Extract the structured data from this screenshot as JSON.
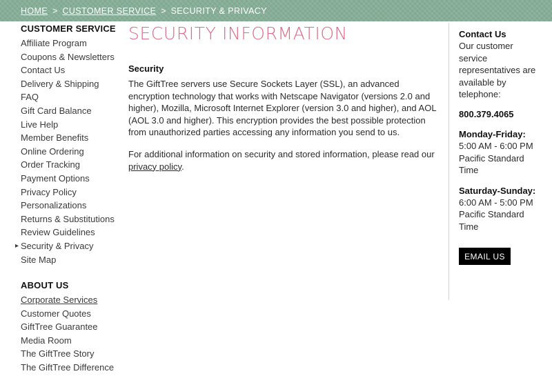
{
  "breadcrumb": {
    "items": [
      {
        "label": "HOME",
        "link": true
      },
      {
        "label": "CUSTOMER SERVICE",
        "link": true
      },
      {
        "label": "SECURITY & PRIVACY",
        "link": false
      }
    ],
    "separator": ">"
  },
  "sidebar": {
    "customer_service": {
      "heading": "CUSTOMER SERVICE",
      "items": [
        {
          "label": "Affiliate Program"
        },
        {
          "label": "Coupons & Newsletters"
        },
        {
          "label": "Contact Us"
        },
        {
          "label": "Delivery & Shipping"
        },
        {
          "label": "FAQ"
        },
        {
          "label": "Gift Card Balance"
        },
        {
          "label": "Live Help"
        },
        {
          "label": "Member Benefits"
        },
        {
          "label": "Online Ordering"
        },
        {
          "label": "Order Tracking"
        },
        {
          "label": "Payment Options"
        },
        {
          "label": "Privacy Policy"
        },
        {
          "label": "Personalizations"
        },
        {
          "label": "Returns & Substitutions"
        },
        {
          "label": "Review Guidelines"
        },
        {
          "label": "Security & Privacy"
        },
        {
          "label": "Site Map"
        }
      ],
      "current_index": 15
    },
    "about_us": {
      "heading": "ABOUT US",
      "items": [
        {
          "label": "Corporate Services"
        },
        {
          "label": "Customer Quotes"
        },
        {
          "label": "GiftTree Guarantee"
        },
        {
          "label": "Media Room"
        },
        {
          "label": "The GiftTree Story"
        },
        {
          "label": "The GiftTree Difference"
        }
      ],
      "hovered_index": 0
    }
  },
  "main": {
    "title": "SECURITY INFORMATION",
    "subheading": "Security",
    "paragraph_1": "The GiftTree servers use Secure Sockets Layer (SSL), an advanced encryption technology that works with Netscape Navigator (versions 2.0 and higher), Mozilla, Microsoft Internet Explorer (version 3.0 and higher), and AOL (AOL 3.0 and higher). This encryption provides the best possible protection from unauthorized parties accessing any information you send to us.",
    "paragraph_2_lead": "For additional information on security and stored information, please read our ",
    "paragraph_2_link": "privacy policy",
    "paragraph_2_tail": "."
  },
  "contact": {
    "heading": "Contact Us",
    "intro": "Our customer service representatives are available by telephone:",
    "phone": "800.379.4065",
    "hours": [
      {
        "days": "Monday-Friday:",
        "time": "5:00 AM - 6:00 PM",
        "timezone": "Pacific Standard Time"
      },
      {
        "days": "Saturday-Sunday:",
        "time": "6:00 AM - 5:00 PM",
        "timezone": "Pacific Standard Time"
      }
    ],
    "email_button": "EMAIL US"
  },
  "colors": {
    "breadcrumb_green": "#81a992",
    "title_pink": "#dd6a86",
    "button_black": "#000000",
    "divider_gray": "#d4d4d4",
    "text_dark": "#2b2b2b"
  }
}
